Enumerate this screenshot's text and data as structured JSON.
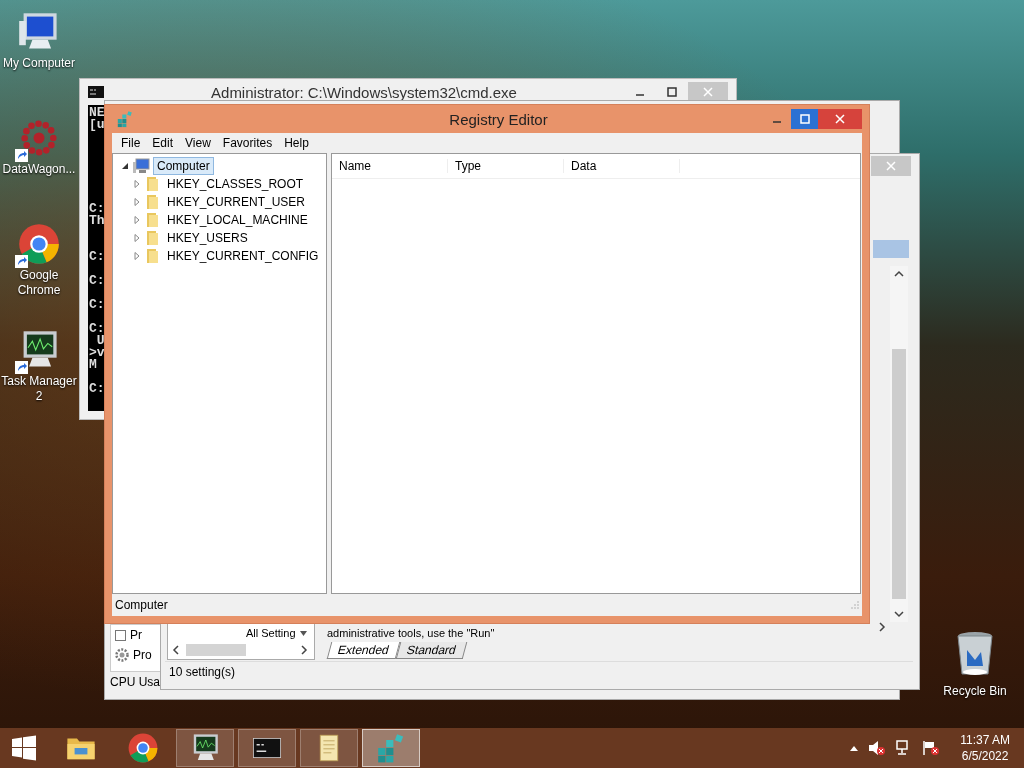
{
  "desktop_icons": [
    {
      "label": "My Computer",
      "kind": "computer",
      "shortcut": false
    },
    {
      "label": "DataWagon...",
      "kind": "datawagon",
      "shortcut": true
    },
    {
      "label": "Google Chrome",
      "kind": "chrome",
      "shortcut": true
    },
    {
      "label": "Task Manager 2",
      "kind": "taskmanager",
      "shortcut": true
    }
  ],
  "recycle_bin": {
    "label": "Recycle Bin"
  },
  "cmd_window": {
    "title": "Administrator: C:\\Windows\\system32\\cmd.exe",
    "lines": [
      "NE",
      "[u",
      "C:",
      "Th",
      "C:",
      "C:",
      "C:",
      "C:",
      " U",
      ">v",
      "M",
      "C:"
    ]
  },
  "task_window": {
    "items": [
      {
        "label": "Pr",
        "kind": "checkbox",
        "checked": false
      },
      {
        "label": "Pro",
        "kind": "gear"
      }
    ],
    "status_bar": "CPU Usa"
  },
  "config_window": {
    "dropdown": "All Setting",
    "description": "administrative tools, use the \"Run\"",
    "tabs": [
      {
        "label": "Extended",
        "selected": true
      },
      {
        "label": "Standard",
        "selected": false
      }
    ],
    "status_bar": "10 setting(s)"
  },
  "registry_editor": {
    "title": "Registry Editor",
    "menu": [
      "File",
      "Edit",
      "View",
      "Favorites",
      "Help"
    ],
    "tree": [
      {
        "label": "Computer",
        "kind": "computer",
        "selected": true,
        "expanded": true,
        "children": [
          {
            "label": "HKEY_CLASSES_ROOT",
            "kind": "folder",
            "selected": false,
            "expanded": false
          },
          {
            "label": "HKEY_CURRENT_USER",
            "kind": "folder",
            "selected": false,
            "expanded": false
          },
          {
            "label": "HKEY_LOCAL_MACHINE",
            "kind": "folder",
            "selected": false,
            "expanded": false
          },
          {
            "label": "HKEY_USERS",
            "kind": "folder",
            "selected": false,
            "expanded": false
          },
          {
            "label": "HKEY_CURRENT_CONFIG",
            "kind": "folder",
            "selected": false,
            "expanded": false
          }
        ]
      }
    ],
    "columns": [
      "Name",
      "Type",
      "Data"
    ],
    "status_bar": "Computer"
  },
  "taskbar": {
    "apps": [
      {
        "kind": "explorer",
        "running": false,
        "selected": false
      },
      {
        "kind": "chrome",
        "running": false,
        "selected": false
      },
      {
        "kind": "taskmanager",
        "running": true,
        "selected": false
      },
      {
        "kind": "cmd",
        "running": true,
        "selected": false
      },
      {
        "kind": "notes",
        "running": true,
        "selected": false
      },
      {
        "kind": "regedit",
        "running": true,
        "selected": true
      }
    ],
    "time": "11:37 AM",
    "date": "6/5/2022"
  }
}
